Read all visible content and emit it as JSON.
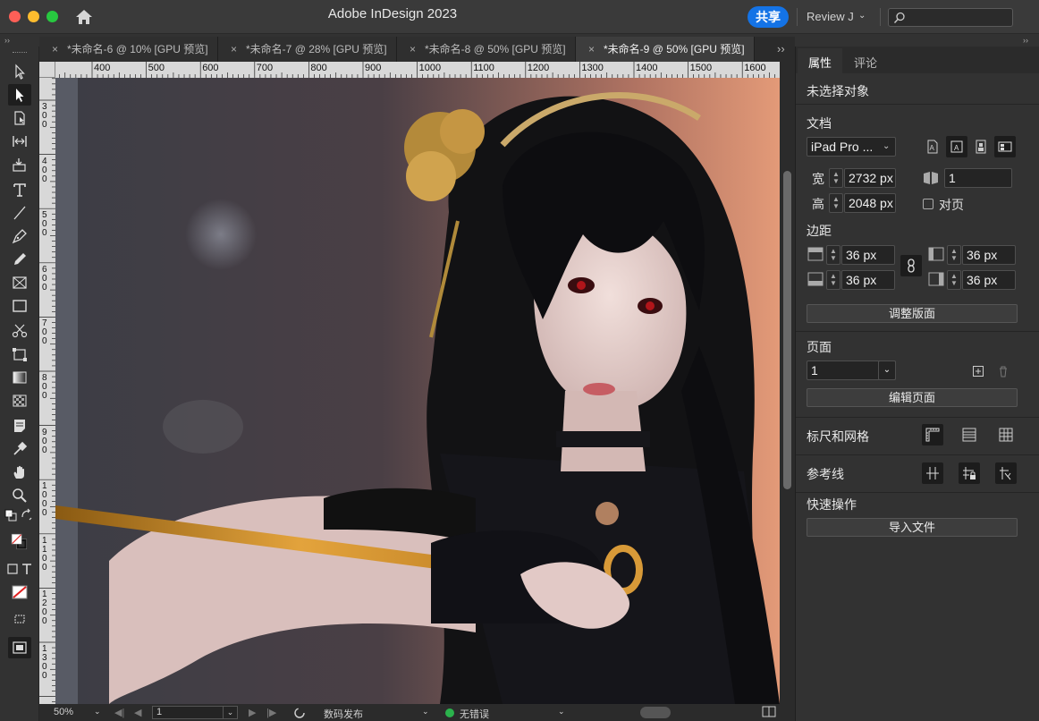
{
  "window": {
    "title": "Adobe InDesign 2023"
  },
  "header": {
    "share_label": "共享",
    "user_label": "Review J",
    "search_placeholder": ""
  },
  "tabs": [
    {
      "label": "*未命名-6 @ 10% [GPU 预览]"
    },
    {
      "label": "*未命名-7 @ 28% [GPU 预览]"
    },
    {
      "label": "*未命名-8 @ 50% [GPU 预览]"
    },
    {
      "label": "*未命名-9 @ 50% [GPU 预览]"
    }
  ],
  "ruler_top": [
    "400",
    "500",
    "600",
    "700",
    "800",
    "900",
    "1000",
    "1100",
    "1200",
    "1300",
    "1400",
    "1500",
    "1600"
  ],
  "ruler_left": [
    "300",
    "400",
    "500",
    "600",
    "700",
    "800",
    "900",
    "1000",
    "1100",
    "1200",
    "1300"
  ],
  "status": {
    "zoom": "50%",
    "page": "1",
    "preset": "数码发布",
    "preflight": "无错误"
  },
  "panel": {
    "tab_properties": "属性",
    "tab_comments": "评论",
    "no_selection": "未选择对象",
    "document_title": "文档",
    "preset_value": "iPad Pro ...",
    "width_label": "宽",
    "width_value": "2732 px",
    "height_label": "高",
    "height_value": "2048 px",
    "pages_value": "1",
    "facing_label": "对页",
    "margins_title": "边距",
    "margin_top": "36 px",
    "margin_bottom": "36 px",
    "margin_left": "36 px",
    "margin_right": "36 px",
    "adjust_layout_label": "调整版面",
    "page_title": "页面",
    "page_value": "1",
    "edit_page_label": "编辑页面",
    "rulers_grids_title": "标尺和网格",
    "guides_title": "参考线",
    "quick_actions_title": "快速操作",
    "import_file_label": "导入文件"
  }
}
